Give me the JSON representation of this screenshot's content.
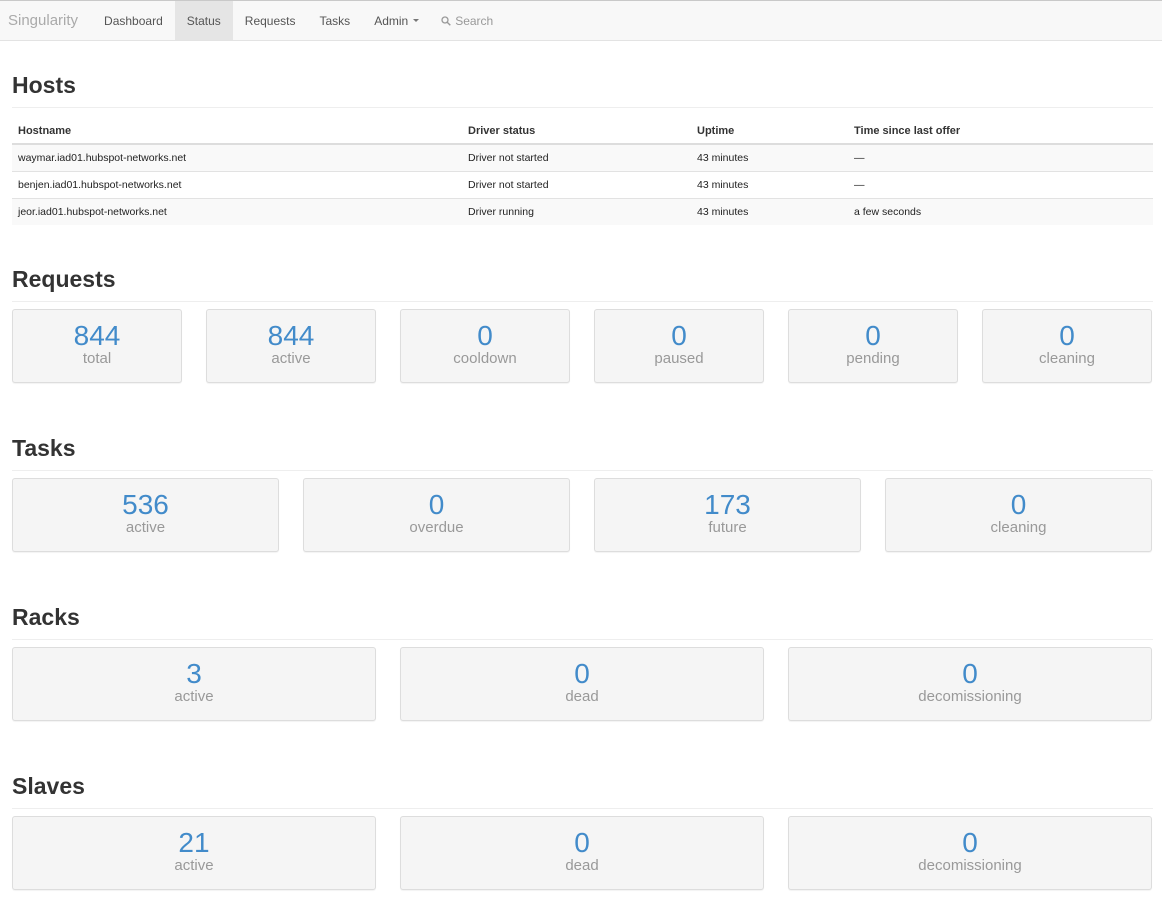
{
  "nav": {
    "brand": "Singularity",
    "items": [
      "Dashboard",
      "Status",
      "Requests",
      "Tasks",
      "Admin"
    ],
    "active": "Status",
    "search_placeholder": "Search"
  },
  "hosts": {
    "title": "Hosts",
    "columns": [
      "Hostname",
      "Driver status",
      "Uptime",
      "Time since last offer"
    ],
    "rows": [
      [
        "waymar.iad01.hubspot-networks.net",
        "Driver not started",
        "43 minutes",
        "—"
      ],
      [
        "benjen.iad01.hubspot-networks.net",
        "Driver not started",
        "43 minutes",
        "—"
      ],
      [
        "jeor.iad01.hubspot-networks.net",
        "Driver running",
        "43 minutes",
        "a few seconds"
      ]
    ]
  },
  "requests": {
    "title": "Requests",
    "stats": [
      {
        "value": "844",
        "label": "total"
      },
      {
        "value": "844",
        "label": "active"
      },
      {
        "value": "0",
        "label": "cooldown"
      },
      {
        "value": "0",
        "label": "paused"
      },
      {
        "value": "0",
        "label": "pending"
      },
      {
        "value": "0",
        "label": "cleaning"
      }
    ]
  },
  "tasks": {
    "title": "Tasks",
    "stats": [
      {
        "value": "536",
        "label": "active"
      },
      {
        "value": "0",
        "label": "overdue"
      },
      {
        "value": "173",
        "label": "future"
      },
      {
        "value": "0",
        "label": "cleaning"
      }
    ]
  },
  "racks": {
    "title": "Racks",
    "stats": [
      {
        "value": "3",
        "label": "active"
      },
      {
        "value": "0",
        "label": "dead"
      },
      {
        "value": "0",
        "label": "decomissioning"
      }
    ]
  },
  "slaves": {
    "title": "Slaves",
    "stats": [
      {
        "value": "21",
        "label": "active"
      },
      {
        "value": "0",
        "label": "dead"
      },
      {
        "value": "0",
        "label": "decomissioning"
      }
    ]
  },
  "colors": {
    "stat_value": "#428bca",
    "stat_label": "#999999",
    "box_bg": "#f5f5f5"
  }
}
